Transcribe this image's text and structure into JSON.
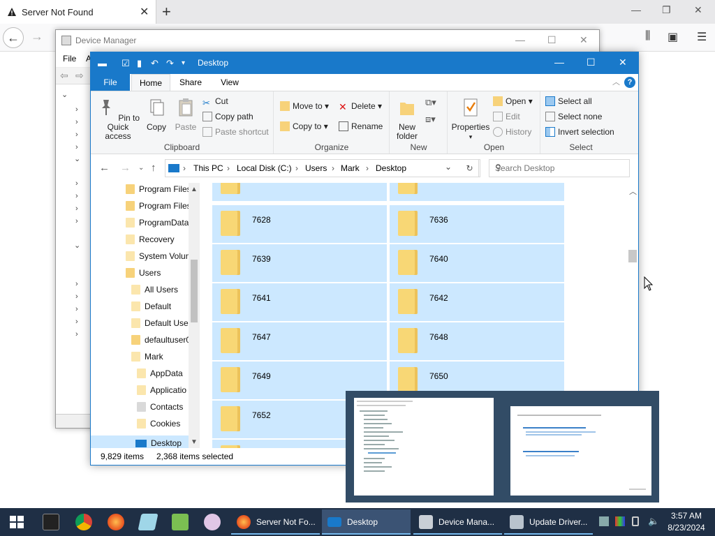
{
  "firefox": {
    "tab_title": "Server Not Found",
    "new_tab": "+",
    "tab_close": "✕",
    "back": "←",
    "forward": "→",
    "win_min": "—",
    "win_restore": "❐",
    "win_close": "✕"
  },
  "device_manager": {
    "title": "Device Manager",
    "menu_file": "File",
    "menu_action": "A",
    "btn_min": "—",
    "btn_max": "☐",
    "btn_close": "✕"
  },
  "explorer": {
    "title": "Desktop",
    "tabs": {
      "file": "File",
      "home": "Home",
      "share": "Share",
      "view": "View"
    },
    "help": "?",
    "ribbon": {
      "clipboard": {
        "label": "Clipboard",
        "pin": "Pin to Quick access",
        "copy": "Copy",
        "paste": "Paste",
        "cut": "Cut",
        "copy_path": "Copy path",
        "paste_shortcut": "Paste shortcut"
      },
      "organize": {
        "label": "Organize",
        "move_to": "Move to",
        "copy_to": "Copy to",
        "delete": "Delete",
        "rename": "Rename"
      },
      "new": {
        "label": "New",
        "new_folder": "New folder"
      },
      "open": {
        "label": "Open",
        "properties": "Properties",
        "open": "Open",
        "edit": "Edit",
        "history": "History"
      },
      "select": {
        "label": "Select",
        "select_all": "Select all",
        "select_none": "Select none",
        "invert": "Invert selection"
      }
    },
    "address": {
      "crumbs": [
        "This PC",
        "Local Disk (C:)",
        "Users",
        "Mark",
        "Desktop"
      ],
      "search_placeholder": "Search Desktop"
    },
    "nav_items": [
      {
        "label": "Program Files"
      },
      {
        "label": "Program Files"
      },
      {
        "label": "ProgramData"
      },
      {
        "label": "Recovery"
      },
      {
        "label": "System Volun"
      },
      {
        "label": "Users"
      },
      {
        "label": "All Users"
      },
      {
        "label": "Default"
      },
      {
        "label": "Default User"
      },
      {
        "label": "defaultuser0"
      },
      {
        "label": "Mark"
      },
      {
        "label": "AppData"
      },
      {
        "label": "Applicatio"
      },
      {
        "label": "Contacts"
      },
      {
        "label": "Cookies"
      },
      {
        "label": "Desktop"
      }
    ],
    "folders": [
      [
        "",
        ""
      ],
      [
        "7628",
        "7636"
      ],
      [
        "7639",
        "7640"
      ],
      [
        "7641",
        "7642"
      ],
      [
        "7647",
        "7648"
      ],
      [
        "7649",
        "7650"
      ],
      [
        "7652",
        ""
      ]
    ],
    "status": {
      "items": "9,829 items",
      "selected": "2,368 items selected"
    }
  },
  "taskbar": {
    "tasks": {
      "firefox": "Server Not Fo...",
      "desktop": "Desktop",
      "devmgr": "Device Mana...",
      "update": "Update Driver..."
    },
    "time": "3:57 AM",
    "date": "8/23/2024"
  },
  "thumbnail_preview": {
    "heading": "How do you want to search for drivers?"
  },
  "colors": {
    "accent": "#1979ca",
    "selection": "#cce8ff",
    "taskbar": "#1f2f45"
  }
}
